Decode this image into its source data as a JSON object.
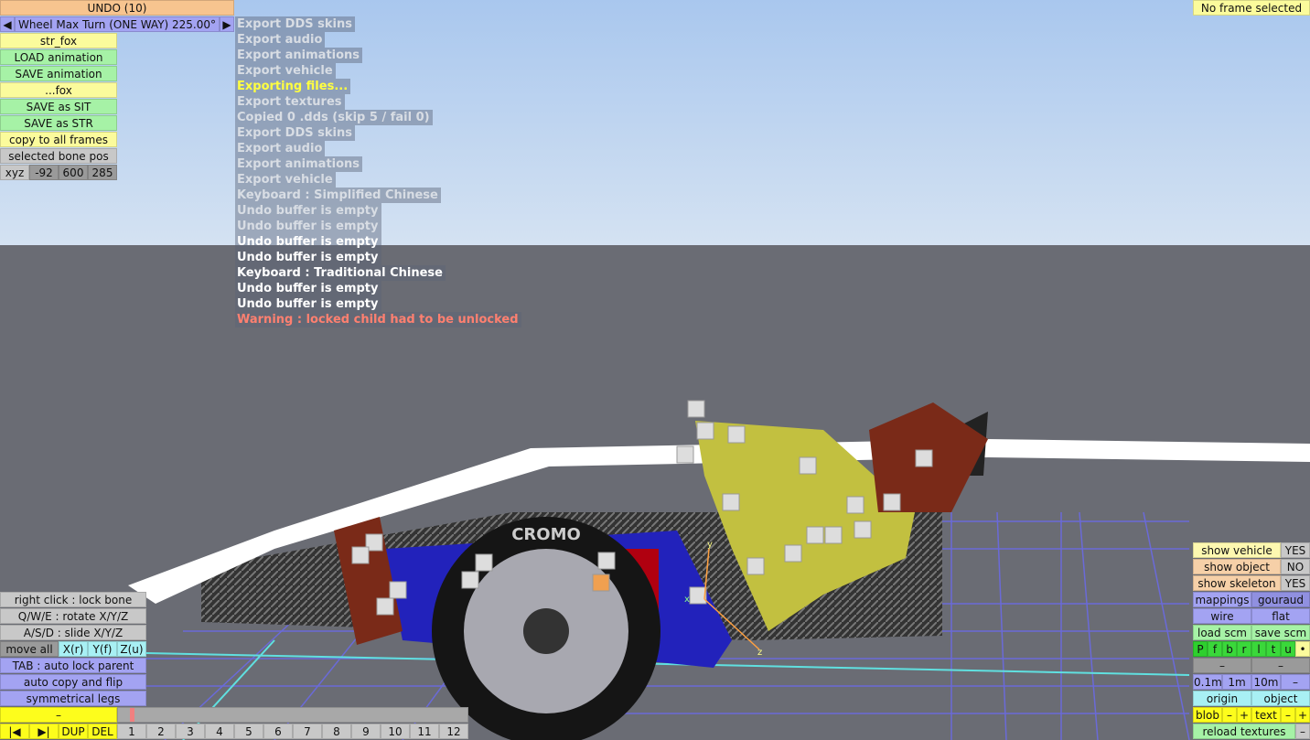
{
  "top": {
    "undo": "UNDO (10)",
    "param_prev": "◀",
    "param": "Wheel Max Turn (ONE WAY) 225.00°",
    "param_next": "▶",
    "no_frame": "No frame selected"
  },
  "left": {
    "items": [
      "str_fox",
      "LOAD animation",
      "SAVE animation",
      "...fox",
      "SAVE as SIT",
      "SAVE as STR",
      "copy to all frames",
      "selected bone pos"
    ],
    "xyz": {
      "label": "xyz",
      "x": "-92",
      "y": "600",
      "z": "285"
    }
  },
  "log": [
    "Export DDS skins",
    "Export audio",
    "Export animations",
    "Export vehicle",
    "Exporting files...",
    "Export textures",
    "Copied 0 .dds (skip 5 / fail 0)",
    "Export DDS skins",
    "Export audio",
    "Export animations",
    "Export vehicle",
    "Keyboard : Simplified Chinese",
    "Undo buffer is empty",
    "Undo buffer is empty",
    "Undo buffer is empty",
    "Undo buffer is empty",
    "Keyboard : Traditional Chinese",
    "Undo buffer is empty",
    "Undo buffer is empty",
    "Warning : locked child had to be unlocked"
  ],
  "bottom_left": {
    "right_click": "right click : lock bone",
    "rotate": "Q/W/E : rotate X/Y/Z",
    "slide": "A/S/D : slide X/Y/Z",
    "move_all": "move all",
    "xr": "X(r)",
    "yf": "Y(f)",
    "zu": "Z(u)",
    "tab": "TAB : auto lock parent",
    "auto_copy": "auto copy and flip",
    "sym": "symmetrical legs",
    "frame_name": "–",
    "first": "|◀",
    "last": "▶|",
    "dup": "DUP",
    "del": "DEL",
    "frames": [
      "1",
      "2",
      "3",
      "4",
      "5",
      "6",
      "7",
      "8",
      "9",
      "10",
      "11",
      "12"
    ],
    "current_frame": 1
  },
  "right": {
    "show_vehicle": "show vehicle",
    "show_vehicle_v": "YES",
    "show_object": "show object",
    "show_object_v": "NO",
    "show_skeleton": "show skeleton",
    "show_skeleton_v": "YES",
    "mappings": "mappings",
    "gouraud": "gouraud",
    "wire": "wire",
    "flat": "flat",
    "load_scm": "load scm",
    "save_scm": "save scm",
    "views": [
      "P",
      "f",
      "b",
      "r",
      "l",
      "t",
      "u"
    ],
    "dot": "•",
    "dash1": "–",
    "dash2": "–",
    "s01": "0.1m",
    "s1": "1m",
    "s10": "10m",
    "sdash": "–",
    "origin": "origin",
    "object": "object",
    "blob": "blob",
    "blob_minus": "–",
    "blob_plus": "+",
    "text": "text",
    "text_minus": "–",
    "text_plus": "+",
    "reload": "reload textures",
    "reload_dash": "–"
  },
  "scene": {
    "tire_text": "CROMO",
    "axis_y": "y",
    "axis_z": "z",
    "axis_x": "x"
  }
}
